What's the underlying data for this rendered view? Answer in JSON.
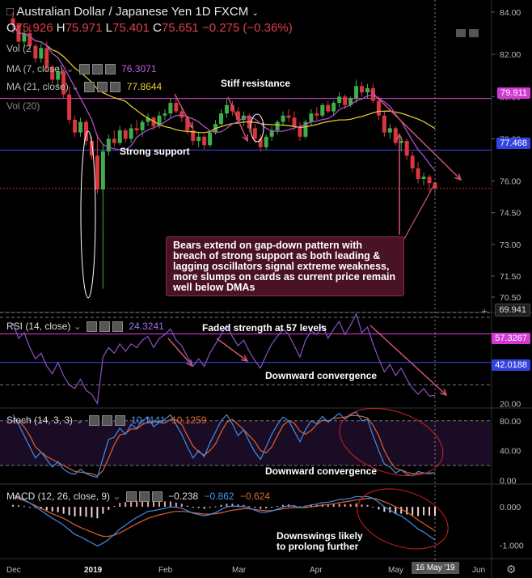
{
  "header": {
    "symbol": "Australian Dollar / Japanese Yen",
    "interval": "1D",
    "source": "FXCM",
    "open_label": "O",
    "open": "75.926",
    "high_label": "H",
    "high": "75.971",
    "low_label": "L",
    "low": "75.401",
    "close_label": "C",
    "close": "75.651",
    "change": "−0.275 (−0.36%)"
  },
  "indicators": {
    "vol_short": "Vol (2",
    "ma7_label": "MA (7, close)",
    "ma7_value": "76.3071",
    "ma21_label": "MA (21, close)",
    "ma21_value": "77.8644",
    "vol20_label": "Vol (20)",
    "rsi_label": "RSI (14, close)",
    "rsi_value": "24.3241",
    "stoch_label": "Stoch (14, 3, 3)",
    "stoch_k": "10.1141",
    "stoch_d": "10.1259",
    "macd_label": "MACD (12, 26, close, 9)",
    "macd_hist": "−0.238",
    "macd_line": "−0.862",
    "macd_signal": "−0.624"
  },
  "annotations": {
    "stiff_resistance": "Stiff resistance",
    "strong_support": "Strong support",
    "callout": "Bears extend on gap-down pattern with breach of strong support as both leading & lagging oscillators signal extreme weakness, more slumps on cards as current price remain well below DMAs",
    "rsi_note": "Faded strength at 57 levels",
    "rsi_conv": "Downward convergence",
    "stoch_conv": "Downward convergence",
    "macd_note_1": "Downswings likely",
    "macd_note_2": "to prolong further"
  },
  "price_labels": {
    "resistance": "79.911",
    "support": "77.468",
    "low_marker": "69.941",
    "rsi_upper": "57.3267",
    "rsi_lower": "42.0188"
  },
  "x_axis": {
    "dec": "Dec",
    "y2019": "2019",
    "feb": "Feb",
    "mar": "Mar",
    "apr": "Apr",
    "may": "May",
    "cursor": "16 May '19",
    "jun": "Jun"
  },
  "colors": {
    "bull": "#3fae49",
    "bear": "#d9363e",
    "ma7": "#b04fc8",
    "ma21": "#e0c52b",
    "resistance": "#e040e0",
    "support": "#3a4cf0",
    "rsi": "#8c52c8",
    "stoch_k": "#3d8ee8",
    "stoch_d": "#e06030",
    "macd": "#3d8ee8",
    "signal": "#e06030",
    "callout_bg": "#4a1225",
    "arrow": "#d05570"
  },
  "chart_data": [
    {
      "type": "candlestick",
      "title": "Australian Dollar / Japanese Yen 1D FXCM",
      "x_ticks": [
        "Dec",
        "2019",
        "Feb",
        "Mar",
        "Apr",
        "May",
        "Jun"
      ],
      "y_ticks": [
        84.0,
        82.0,
        80.0,
        78.0,
        76.0,
        74.5,
        73.0,
        71.5,
        70.5
      ],
      "ylim": [
        70.3,
        84.2
      ],
      "horizontal_lines": {
        "resistance": 79.911,
        "support": 77.468,
        "current": 75.651
      },
      "candles_ohlc": [
        [
          83.7,
          84.0,
          83.0,
          83.4
        ],
        [
          83.4,
          83.5,
          82.4,
          82.6
        ],
        [
          82.6,
          83.2,
          82.3,
          83.0
        ],
        [
          83.0,
          83.4,
          82.2,
          82.4
        ],
        [
          82.4,
          82.5,
          81.6,
          81.8
        ],
        [
          81.8,
          82.5,
          81.6,
          82.3
        ],
        [
          82.3,
          82.6,
          81.2,
          81.4
        ],
        [
          81.4,
          81.5,
          80.6,
          80.8
        ],
        [
          80.8,
          81.4,
          80.4,
          81.2
        ],
        [
          81.2,
          81.3,
          79.9,
          80.1
        ],
        [
          80.1,
          80.5,
          78.7,
          78.9
        ],
        [
          78.9,
          79.1,
          78.1,
          78.3
        ],
        [
          78.3,
          79.0,
          78.1,
          78.8
        ],
        [
          78.8,
          78.9,
          77.7,
          77.9
        ],
        [
          77.9,
          78.1,
          77.0,
          77.2
        ],
        [
          77.2,
          78.2,
          75.4,
          75.6
        ],
        [
          75.6,
          77.7,
          70.9,
          77.4
        ],
        [
          77.4,
          78.2,
          77.2,
          78.0
        ],
        [
          78.0,
          78.4,
          77.6,
          77.8
        ],
        [
          77.8,
          78.6,
          77.7,
          78.4
        ],
        [
          78.4,
          78.5,
          77.8,
          78.0
        ],
        [
          78.0,
          78.7,
          77.8,
          78.5
        ],
        [
          78.5,
          78.9,
          78.2,
          78.4
        ],
        [
          78.4,
          78.9,
          78.1,
          78.8
        ],
        [
          78.8,
          79.2,
          78.6,
          79.0
        ],
        [
          79.0,
          79.1,
          78.4,
          78.6
        ],
        [
          78.6,
          79.3,
          78.5,
          79.1
        ],
        [
          79.1,
          79.4,
          78.9,
          79.2
        ],
        [
          79.2,
          79.9,
          79.0,
          79.7
        ],
        [
          79.7,
          79.9,
          79.2,
          79.3
        ],
        [
          79.3,
          79.5,
          78.8,
          79.0
        ],
        [
          79.0,
          79.1,
          78.2,
          78.4
        ],
        [
          78.4,
          78.6,
          77.7,
          77.9
        ],
        [
          77.9,
          78.3,
          77.6,
          78.1
        ],
        [
          78.1,
          78.2,
          77.5,
          77.7
        ],
        [
          77.7,
          78.4,
          77.6,
          78.3
        ],
        [
          78.3,
          78.9,
          78.2,
          78.7
        ],
        [
          78.7,
          79.4,
          78.6,
          79.2
        ],
        [
          79.2,
          79.9,
          79.0,
          79.6
        ],
        [
          79.6,
          79.8,
          79.1,
          79.3
        ],
        [
          79.3,
          79.5,
          78.7,
          78.9
        ],
        [
          78.9,
          79.3,
          78.6,
          79.1
        ],
        [
          79.1,
          79.2,
          78.3,
          78.5
        ],
        [
          78.5,
          78.7,
          77.8,
          78.0
        ],
        [
          78.0,
          78.2,
          77.4,
          77.6
        ],
        [
          77.6,
          78.2,
          77.5,
          78.1
        ],
        [
          78.1,
          78.6,
          77.9,
          78.4
        ],
        [
          78.4,
          78.9,
          78.2,
          78.8
        ],
        [
          78.8,
          79.3,
          78.6,
          79.1
        ],
        [
          79.1,
          79.4,
          78.8,
          79.0
        ],
        [
          79.0,
          79.3,
          78.4,
          78.6
        ],
        [
          78.6,
          78.8,
          77.9,
          78.1
        ],
        [
          78.1,
          78.9,
          78.0,
          78.8
        ],
        [
          78.8,
          79.4,
          78.6,
          79.2
        ],
        [
          79.2,
          79.5,
          78.9,
          79.1
        ],
        [
          79.1,
          79.7,
          79.0,
          79.6
        ],
        [
          79.6,
          79.8,
          79.2,
          79.3
        ],
        [
          79.3,
          79.8,
          79.1,
          79.7
        ],
        [
          79.7,
          80.2,
          79.5,
          80.0
        ],
        [
          80.0,
          80.1,
          79.4,
          79.6
        ],
        [
          79.6,
          80.0,
          79.5,
          79.9
        ],
        [
          79.9,
          80.8,
          79.7,
          80.5
        ],
        [
          80.5,
          80.7,
          80.0,
          80.2
        ],
        [
          80.2,
          80.6,
          79.9,
          80.4
        ],
        [
          80.4,
          80.6,
          79.7,
          79.8
        ],
        [
          79.8,
          80.0,
          78.9,
          79.1
        ],
        [
          79.1,
          79.3,
          78.1,
          78.3
        ],
        [
          78.3,
          78.7,
          78.0,
          78.5
        ],
        [
          78.5,
          78.6,
          77.7,
          77.8
        ],
        [
          77.8,
          78.1,
          77.4,
          77.9
        ],
        [
          77.9,
          78.0,
          77.0,
          77.2
        ],
        [
          77.2,
          77.4,
          76.4,
          76.6
        ],
        [
          76.6,
          76.9,
          75.9,
          76.1
        ],
        [
          76.1,
          76.4,
          75.8,
          76.2
        ],
        [
          76.2,
          76.3,
          75.5,
          75.9
        ],
        [
          75.926,
          75.971,
          75.401,
          75.651
        ]
      ],
      "series": [
        {
          "name": "MA (7, close)",
          "last": 76.3071
        },
        {
          "name": "MA (21, close)",
          "last": 77.8644
        }
      ]
    },
    {
      "type": "line",
      "title": "RSI (14, close)",
      "y_ticks": [
        20.0
      ],
      "ylim": [
        18,
        68
      ],
      "levels": [
        57.3267,
        42.0188
      ],
      "series": [
        {
          "name": "RSI (14, close)",
          "last": 24.3241,
          "values": [
            63,
            55,
            58,
            50,
            44,
            47,
            40,
            36,
            42,
            35,
            30,
            28,
            33,
            27,
            25,
            20,
            45,
            50,
            47,
            52,
            48,
            52,
            50,
            54,
            56,
            50,
            55,
            57,
            60,
            54,
            51,
            45,
            40,
            44,
            40,
            47,
            52,
            57,
            62,
            56,
            51,
            54,
            48,
            43,
            39,
            46,
            52,
            56,
            60,
            57,
            51,
            45,
            54,
            59,
            57,
            62,
            55,
            60,
            64,
            57,
            62,
            68,
            58,
            61,
            52,
            44,
            37,
            41,
            35,
            39,
            33,
            28,
            25,
            28,
            24,
            24.3
          ]
        }
      ]
    },
    {
      "type": "line",
      "title": "Stoch (14, 3, 3)",
      "y_ticks": [
        80.0,
        40.0,
        0.0
      ],
      "ylim": [
        -5,
        95
      ],
      "series": [
        {
          "name": "%K",
          "last": 10.1141,
          "values": [
            88,
            75,
            60,
            45,
            30,
            38,
            28,
            18,
            25,
            15,
            10,
            8,
            15,
            9,
            6,
            4,
            30,
            55,
            58,
            70,
            62,
            75,
            70,
            80,
            85,
            72,
            78,
            82,
            88,
            75,
            62,
            45,
            30,
            40,
            32,
            50,
            65,
            80,
            88,
            76,
            60,
            68,
            52,
            38,
            28,
            45,
            62,
            75,
            85,
            80,
            66,
            52,
            68,
            80,
            76,
            86,
            78,
            84,
            90,
            82,
            88,
            92,
            80,
            82,
            60,
            40,
            22,
            18,
            10,
            14,
            8,
            6,
            12,
            10,
            9,
            10.1
          ]
        },
        {
          "name": "%D",
          "last": 10.1259,
          "values": [
            80,
            80,
            72,
            60,
            45,
            38,
            32,
            28,
            24,
            20,
            16,
            12,
            11,
            10,
            9,
            6,
            13,
            30,
            48,
            61,
            63,
            69,
            69,
            75,
            78,
            79,
            78,
            77,
            82,
            81,
            75,
            60,
            46,
            38,
            34,
            40,
            49,
            65,
            78,
            82,
            75,
            68,
            60,
            52,
            40,
            37,
            45,
            60,
            74,
            80,
            77,
            66,
            62,
            67,
            75,
            81,
            80,
            83,
            84,
            85,
            87,
            87,
            86,
            84,
            74,
            60,
            40,
            26,
            16,
            14,
            11,
            9,
            9,
            9,
            10,
            10.1
          ]
        }
      ]
    },
    {
      "type": "bar",
      "title": "MACD (12, 26, close, 9)",
      "y_ticks": [
        0.0,
        -1.0
      ],
      "ylim": [
        -1.35,
        0.55
      ],
      "series": [
        {
          "name": "Histogram",
          "last": -0.238,
          "values": [
            0.05,
            0.04,
            0.02,
            0.0,
            -0.03,
            -0.06,
            -0.09,
            -0.12,
            -0.14,
            -0.18,
            -0.22,
            -0.25,
            -0.24,
            -0.26,
            -0.28,
            -0.3,
            -0.18,
            -0.08,
            0.02,
            0.1,
            0.12,
            0.15,
            0.16,
            0.17,
            0.18,
            0.15,
            0.14,
            0.14,
            0.14,
            0.11,
            0.08,
            0.03,
            -0.02,
            -0.03,
            -0.05,
            -0.02,
            0.01,
            0.05,
            0.08,
            0.08,
            0.06,
            0.05,
            0.02,
            -0.02,
            -0.05,
            -0.04,
            -0.01,
            0.02,
            0.05,
            0.06,
            0.04,
            0.01,
            0.03,
            0.05,
            0.05,
            0.07,
            0.06,
            0.07,
            0.08,
            0.07,
            0.07,
            0.09,
            0.06,
            0.05,
            0.0,
            -0.07,
            -0.13,
            -0.15,
            -0.18,
            -0.18,
            -0.2,
            -0.22,
            -0.24,
            -0.22,
            -0.23,
            -0.238
          ]
        },
        {
          "name": "MACD",
          "last": -0.862,
          "values": [
            0.3,
            0.25,
            0.18,
            0.1,
            0.0,
            -0.1,
            -0.2,
            -0.3,
            -0.38,
            -0.48,
            -0.6,
            -0.72,
            -0.78,
            -0.86,
            -0.94,
            -1.02,
            -0.95,
            -0.85,
            -0.72,
            -0.58,
            -0.48,
            -0.37,
            -0.28,
            -0.2,
            -0.12,
            -0.1,
            -0.07,
            -0.04,
            0.0,
            -0.01,
            -0.04,
            -0.1,
            -0.17,
            -0.2,
            -0.24,
            -0.2,
            -0.15,
            -0.07,
            0.0,
            0.02,
            0.01,
            0.01,
            -0.03,
            -0.09,
            -0.14,
            -0.14,
            -0.11,
            -0.06,
            0.0,
            0.03,
            0.02,
            -0.02,
            0.01,
            0.05,
            0.07,
            0.11,
            0.12,
            0.15,
            0.19,
            0.2,
            0.22,
            0.27,
            0.26,
            0.27,
            0.22,
            0.12,
            0.0,
            -0.08,
            -0.18,
            -0.24,
            -0.34,
            -0.46,
            -0.58,
            -0.66,
            -0.76,
            -0.862
          ]
        },
        {
          "name": "Signal",
          "last": -0.624,
          "values": [
            0.25,
            0.21,
            0.16,
            0.1,
            0.03,
            -0.04,
            -0.11,
            -0.18,
            -0.24,
            -0.3,
            -0.38,
            -0.47,
            -0.54,
            -0.6,
            -0.66,
            -0.72,
            -0.77,
            -0.77,
            -0.74,
            -0.68,
            -0.6,
            -0.52,
            -0.44,
            -0.37,
            -0.3,
            -0.25,
            -0.21,
            -0.18,
            -0.14,
            -0.12,
            -0.12,
            -0.13,
            -0.15,
            -0.17,
            -0.19,
            -0.19,
            -0.18,
            -0.16,
            -0.12,
            -0.09,
            -0.07,
            -0.05,
            -0.05,
            -0.07,
            -0.09,
            -0.1,
            -0.1,
            -0.08,
            -0.05,
            -0.03,
            -0.02,
            -0.02,
            -0.02,
            0.0,
            0.02,
            0.04,
            0.06,
            0.08,
            0.11,
            0.13,
            0.15,
            0.18,
            0.2,
            0.22,
            0.22,
            0.19,
            0.13,
            0.07,
            0.0,
            -0.06,
            -0.14,
            -0.24,
            -0.34,
            -0.44,
            -0.53,
            -0.624
          ]
        }
      ]
    }
  ]
}
